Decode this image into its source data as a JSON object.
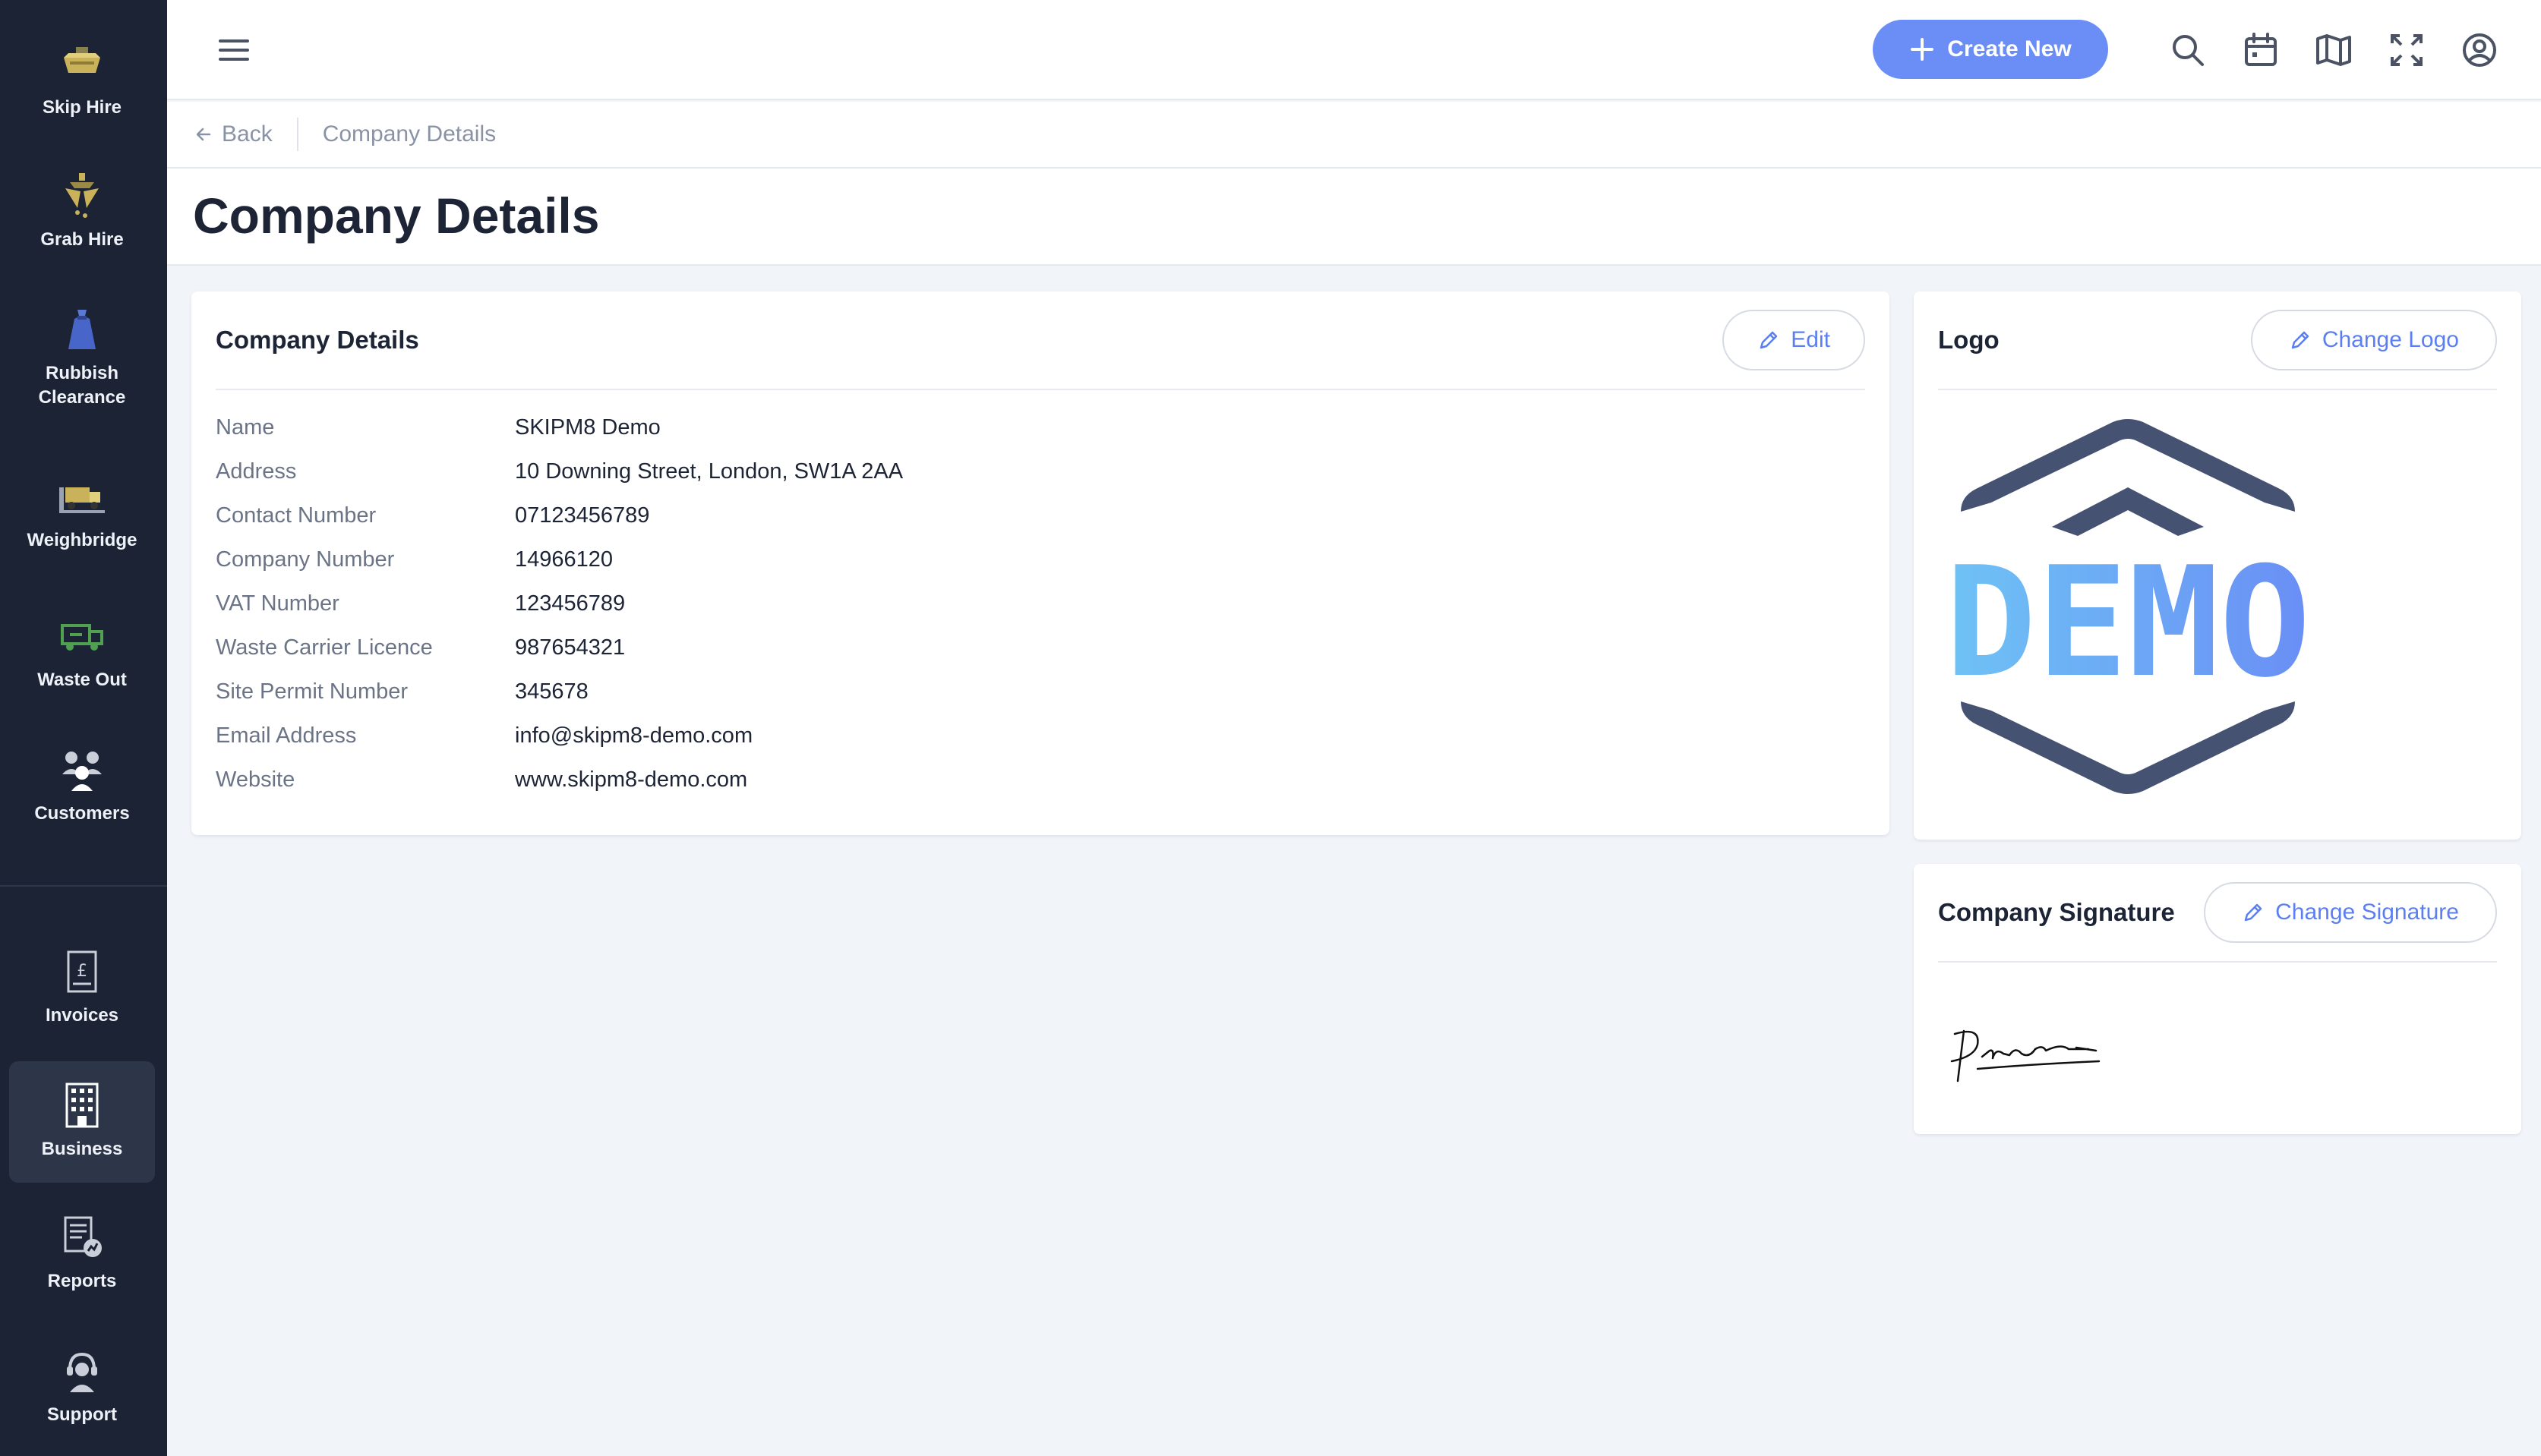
{
  "sidebar": {
    "items": [
      {
        "label": "Skip Hire",
        "icon": "skip-icon"
      },
      {
        "label": "Grab Hire",
        "icon": "grab-icon"
      },
      {
        "label": "Rubbish\nClearance",
        "icon": "rubbish-bag-icon"
      },
      {
        "label": "Weighbridge",
        "icon": "weighbridge-truck-icon"
      },
      {
        "label": "Waste Out",
        "icon": "waste-out-truck-icon"
      },
      {
        "label": "Customers",
        "icon": "customers-icon"
      },
      {
        "label": "Invoices",
        "icon": "invoice-icon"
      },
      {
        "label": "Business",
        "icon": "business-building-icon",
        "active": true
      },
      {
        "label": "Reports",
        "icon": "reports-icon"
      },
      {
        "label": "Support",
        "icon": "support-headset-icon"
      }
    ]
  },
  "topbar": {
    "create_label": "Create New",
    "icons": [
      "search-icon",
      "calendar-icon",
      "map-icon",
      "fullscreen-icon",
      "user-account-icon"
    ]
  },
  "breadcrumb": {
    "back_label": "Back",
    "current": "Company Details"
  },
  "page": {
    "title": "Company Details"
  },
  "details_card": {
    "title": "Company Details",
    "edit_label": "Edit",
    "fields": [
      {
        "label": "Name",
        "value": "SKIPM8 Demo"
      },
      {
        "label": "Address",
        "value": "10 Downing Street, London, SW1A 2AA"
      },
      {
        "label": "Contact Number",
        "value": "07123456789"
      },
      {
        "label": "Company Number",
        "value": "14966120"
      },
      {
        "label": "VAT Number",
        "value": "123456789"
      },
      {
        "label": "Waste Carrier Licence",
        "value": "987654321"
      },
      {
        "label": "Site Permit Number",
        "value": "345678"
      },
      {
        "label": "Email Address",
        "value": "info@skipm8-demo.com"
      },
      {
        "label": "Website",
        "value": "www.skipm8-demo.com"
      }
    ]
  },
  "logo_card": {
    "title": "Logo",
    "change_label": "Change Logo",
    "logo_text": "DEMO"
  },
  "signature_card": {
    "title": "Company Signature",
    "change_label": "Change Signature"
  },
  "colors": {
    "sidebar_bg": "#1b2334",
    "accent": "#6a8ef5",
    "link": "#5b7ff0",
    "logo_dark": "#465271",
    "logo_light": "#6ec3f5",
    "logo_mid": "#6a8ef5"
  }
}
